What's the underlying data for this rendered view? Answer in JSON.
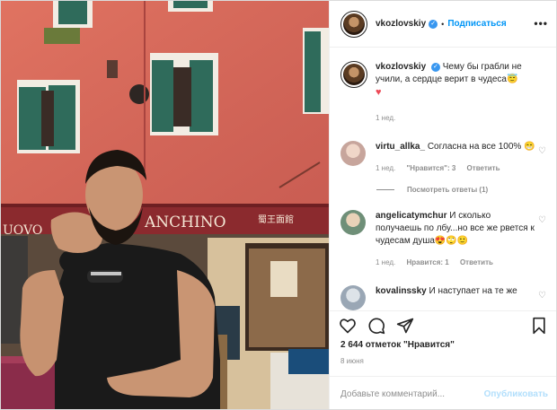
{
  "post": {
    "username": "vkozlovskiy",
    "follow_label": "Подписаться",
    "separator": "•",
    "more_label": "•••"
  },
  "photo": {
    "sign_left": "UOVO",
    "sign_main": "ANCHINO",
    "sign_chinese": "蜀王面館"
  },
  "caption": {
    "username": "vkozlovskiy",
    "text": "Чему бы грабли не учили, а сердце верит в чудеса😇",
    "emoji": "♥",
    "time": "1 нед."
  },
  "comments": [
    {
      "username": "virtu_allka_",
      "text": "Согласна на все 100% 😁",
      "time": "1 нед.",
      "likes": "\"Нравится\": 3",
      "reply": "Ответить",
      "avatar_color": "#c7a59c"
    },
    {
      "username": "angelicatymchur",
      "text": "И сколько получаешь по лбу...но все же рвется к чудесам душа😍🙄🙂",
      "time": "1 нед.",
      "likes": "Нравится: 1",
      "reply": "Ответить",
      "avatar_color": "#6f8f78"
    },
    {
      "username": "kovalinsskу",
      "text": "И наступает на те же",
      "avatar_color": "#9aa7b5"
    }
  ],
  "view_replies": "Посмотреть ответы (1)",
  "likes_text": "2 644 отметок \"Нравится\"",
  "date": "8 июня",
  "add_comment": {
    "placeholder": "Добавьте комментарий...",
    "publish_label": "Опубликовать"
  },
  "colors": {
    "accent": "#0095f6",
    "wall": "#d96b5a",
    "shutter": "#2f6b5b",
    "awning": "#8b2a2e"
  }
}
